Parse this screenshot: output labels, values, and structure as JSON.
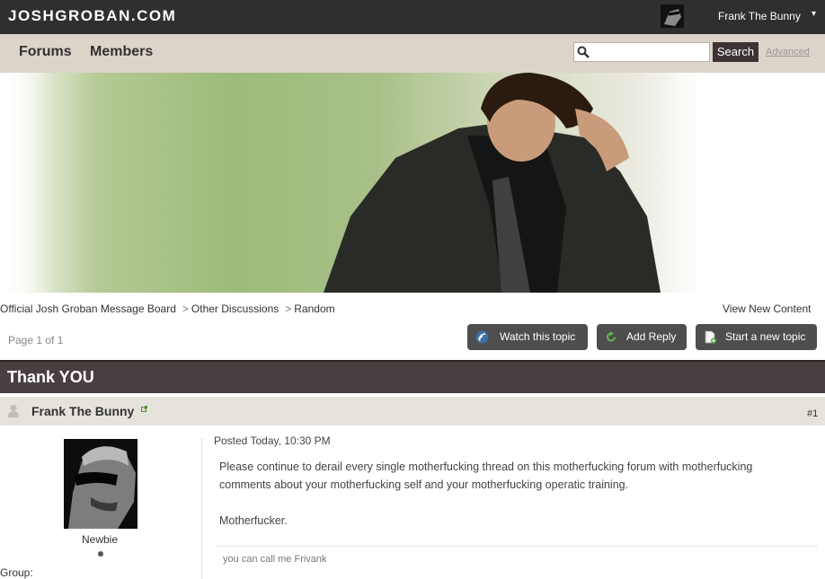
{
  "site": {
    "logo": "JOSHGROBAN.COM"
  },
  "user_menu": {
    "username": "Frank The Bunny",
    "caret": "▾"
  },
  "nav": {
    "forums": "Forums",
    "members": "Members"
  },
  "search": {
    "placeholder": "",
    "button": "Search",
    "advanced": "Advanced"
  },
  "breadcrumb": {
    "items": [
      "Official Josh Groban Message Board",
      "Other Discussions",
      "Random"
    ],
    "separator": ">"
  },
  "view_new": "View New Content",
  "pagination": {
    "label": "Page 1 of 1"
  },
  "actions": {
    "watch": "Watch this topic",
    "reply": "Add Reply",
    "new_topic": "Start a new topic"
  },
  "topic": {
    "title": "Thank YOU"
  },
  "post": {
    "author": "Frank The Bunny",
    "number": "#1",
    "group_name": "Newbie",
    "group_label": "Group:",
    "date": "Posted Today, 10:30 PM",
    "body_p1": "Please continue to derail every single motherfucking thread on this motherfucking forum with motherfucking comments about your motherfucking self and your motherfucking operatic training.",
    "body_p2": "Motherfucker.",
    "signature": "you can call me Frivank"
  },
  "colors": {
    "topbar": "#2f2f2f",
    "navbar": "#dcd4c9",
    "topic_bar": "#4a3f40",
    "button": "#4e4e4e",
    "post_header": "#e6e2dc"
  }
}
